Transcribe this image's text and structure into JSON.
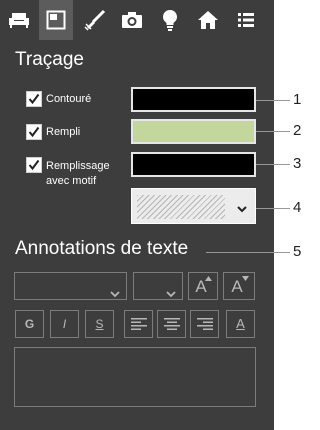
{
  "toolbar": {
    "tabs": [
      {
        "icon": "sofa-icon"
      },
      {
        "icon": "layout-icon",
        "active": true
      },
      {
        "icon": "brush-icon"
      },
      {
        "icon": "camera-icon"
      },
      {
        "icon": "lightbulb-icon"
      },
      {
        "icon": "home-icon"
      },
      {
        "icon": "list-icon"
      }
    ]
  },
  "tracage": {
    "title": "Traçage",
    "options": [
      {
        "label": "Contouré",
        "checked": true,
        "color": "#000000"
      },
      {
        "label": "Rempli",
        "checked": true,
        "color": "#c3d69b"
      },
      {
        "label_line1": "Remplissage",
        "label_line2": "avec motif",
        "checked": true,
        "color": "#000000"
      }
    ],
    "pattern": {
      "icon": "chevron-down-icon"
    }
  },
  "annotations": {
    "title": "Annotations de texte",
    "font_buttons": {
      "grow": "A",
      "shrink": "A"
    },
    "style_buttons": {
      "bold": "G",
      "italic": "I",
      "strike": "S",
      "font_color": "A"
    }
  },
  "callouts": [
    "1",
    "2",
    "3",
    "4",
    "5"
  ]
}
